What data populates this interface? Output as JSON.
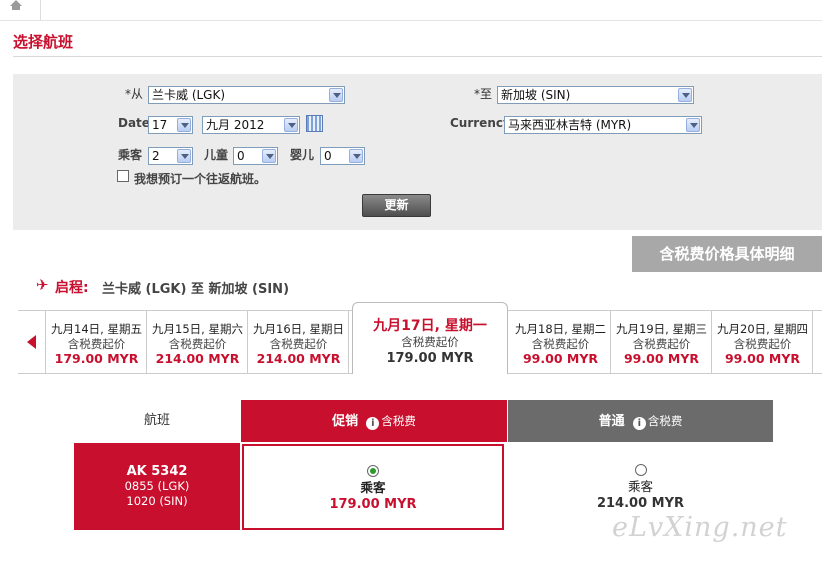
{
  "page": {
    "title": "选择航班"
  },
  "search": {
    "from_label": "*从",
    "from_value": "兰卡威 (LGK)",
    "to_label": "*至",
    "to_value": "新加坡 (SIN)",
    "date_label": "Date",
    "date_day": "17",
    "date_month": "九月 2012",
    "currency_label": "Currency",
    "currency_value": "马来西亚林吉特 (MYR)",
    "passengers_label": "乘客",
    "passengers_value": "2",
    "children_label": "儿童",
    "children_value": "0",
    "infants_label": "婴儿",
    "infants_value": "0",
    "return_checkbox_label": "我想预订一个往返航班。",
    "return_checked": false,
    "update_button": "更新"
  },
  "tax_detail_button": "含税费价格具体明细",
  "journey": {
    "label": "启程:",
    "route_from": "兰卡威 (LGK)",
    "route_to_word": "至",
    "route_to": "新加坡 (SIN)"
  },
  "date_strip": {
    "days": [
      {
        "date": "九月14日, 星期五",
        "sub": "含税费起价",
        "price": "179.00 MYR"
      },
      {
        "date": "九月15日, 星期六",
        "sub": "含税费起价",
        "price": "214.00 MYR"
      },
      {
        "date": "九月16日, 星期日",
        "sub": "含税费起价",
        "price": "214.00 MYR"
      },
      {
        "date": "九月17日, 星期一",
        "sub": "含税费起价",
        "price": "179.00 MYR",
        "selected": true
      },
      {
        "date": "九月18日, 星期二",
        "sub": "含税费起价",
        "price": "99.00 MYR"
      },
      {
        "date": "九月19日, 星期三",
        "sub": "含税费起价",
        "price": "99.00 MYR"
      },
      {
        "date": "九月20日, 星期四",
        "sub": "含税费起价",
        "price": "99.00 MYR"
      }
    ]
  },
  "results": {
    "col_flight": "航班",
    "col_promo": "促销",
    "col_std": "普通",
    "tax_note": "含税费",
    "rows": [
      {
        "flight_no": "AK  5342",
        "depart": "0855 (LGK)",
        "arrive": "1020 (SIN)",
        "promo_pax": "乘客",
        "promo_price": "179.00 MYR",
        "std_pax": "乘客",
        "std_price": "214.00 MYR",
        "selected": "promo"
      }
    ]
  },
  "watermark": "eLvXing.net",
  "colors": {
    "accent": "#c8102e",
    "std_header": "#6b6b6b",
    "panel": "#ececec"
  }
}
